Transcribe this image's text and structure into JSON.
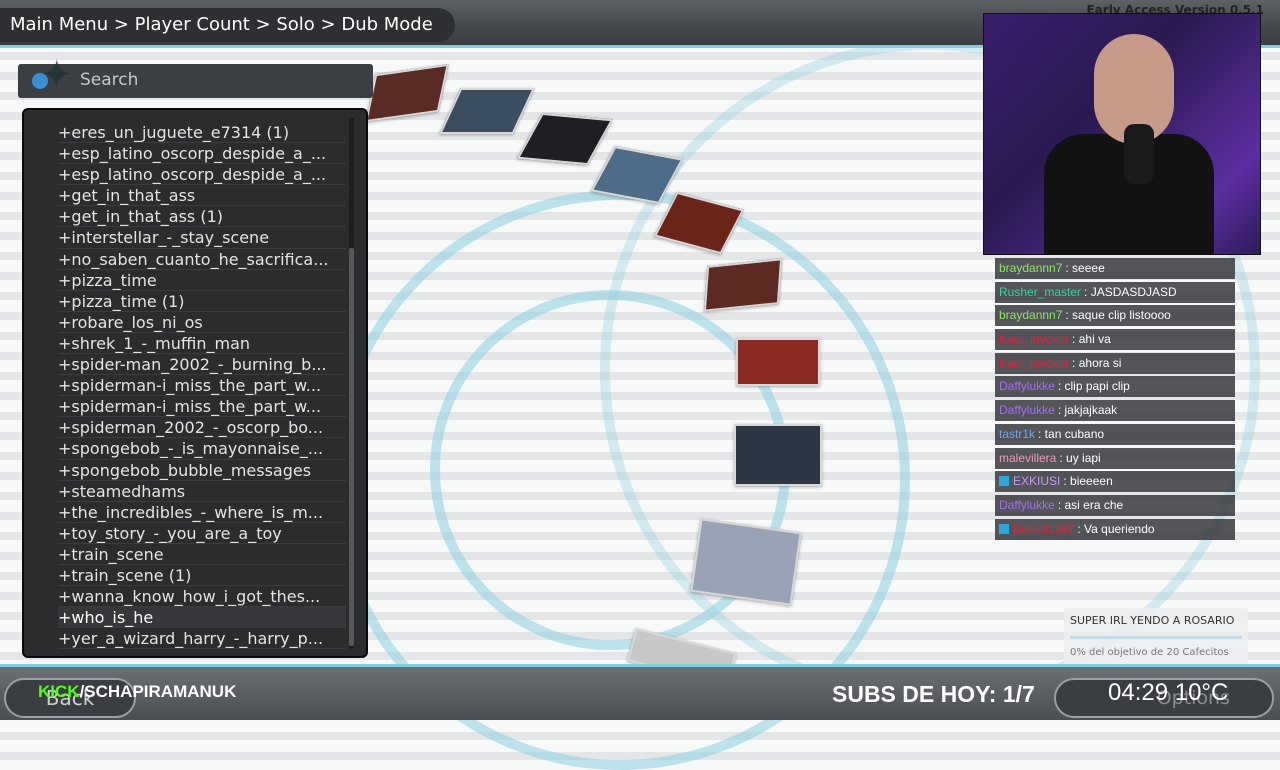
{
  "header": {
    "breadcrumb": "Main Menu > Player Count > Solo > Dub Mode",
    "version": "Early Access Version 0.5.1"
  },
  "search": {
    "placeholder": "Search"
  },
  "list": {
    "items": [
      "+eres_un_juguete_e7314 (1)",
      "+esp_latino_oscorp_despide_a_...",
      "+esp_latino_oscorp_despide_a_...",
      "+get_in_that_ass",
      "+get_in_that_ass (1)",
      "+interstellar_-_stay_scene",
      "+no_saben_cuanto_he_sacrifica...",
      "+pizza_time",
      "+pizza_time (1)",
      "+robare_los_ni_os",
      "+shrek_1_-_muffin_man",
      "+spider-man_2002_-_burning_b...",
      "+spiderman-i_miss_the_part_w...",
      "+spiderman-i_miss_the_part_w...",
      "+spiderman_2002_-_oscorp_bo...",
      "+spongebob_-_is_mayonnaise_...",
      "+spongebob_bubble_messages",
      "+steamedhams",
      "+the_incredibles_-_where_is_m...",
      "+toy_story_-_you_are_a_toy",
      "+train_scene",
      "+train_scene (1)",
      "+wanna_know_how_i_got_thes...",
      "+who_is_he",
      "+yer_a_wizard_harry_-_harry_p..."
    ],
    "selected_index": 23
  },
  "chat": {
    "messages": [
      {
        "user": "braydannn7",
        "color": "#8fe36a",
        "text": ": seeee",
        "badge": false
      },
      {
        "user": "Rusher_master",
        "color": "#3ad2a0",
        "text": ": JASDASDJASD",
        "badge": false
      },
      {
        "user": "braydannn7",
        "color": "#8fe36a",
        "text": ": saque clip listoooo",
        "badge": false
      },
      {
        "user": "Kael_Invoker",
        "color": "#e0203a",
        "text": ": ahi va",
        "badge": false
      },
      {
        "user": "Kael_Invoker",
        "color": "#e0203a",
        "text": ": ahora si",
        "badge": false
      },
      {
        "user": "Daffylukke",
        "color": "#a86cf0",
        "text": ": clip papi clip",
        "badge": false
      },
      {
        "user": "Daffylukke",
        "color": "#a86cf0",
        "text": ": jakjajkaak",
        "badge": false
      },
      {
        "user": "tastr1k",
        "color": "#6fa8e8",
        "text": ": tan cubano",
        "badge": false
      },
      {
        "user": "malevillera",
        "color": "#f09abf",
        "text": ": uy iapi",
        "badge": false
      },
      {
        "user": "EXKIUSI",
        "color": "#c39cf5",
        "text": ": bieeeen",
        "badge": true
      },
      {
        "user": "Daffylukke",
        "color": "#a86cf0",
        "text": ": asi era che",
        "badge": false
      },
      {
        "user": "Darkel1987",
        "color": "#e0203a",
        "text": ": Va queriendo",
        "badge": true
      }
    ]
  },
  "goal": {
    "title": "SUPER IRL YENDO A ROSARIO",
    "subtitle": "0% del objetivo de 20 Cafecitos",
    "progress": 0
  },
  "footer": {
    "back_label": "Back",
    "kick_prefix": "KICK",
    "kick_channel": "/SCHAPIRAMANUK",
    "subs": "SUBS DE HOY: 1/7",
    "options_label": "Options",
    "clock": "04:29  10°C"
  }
}
